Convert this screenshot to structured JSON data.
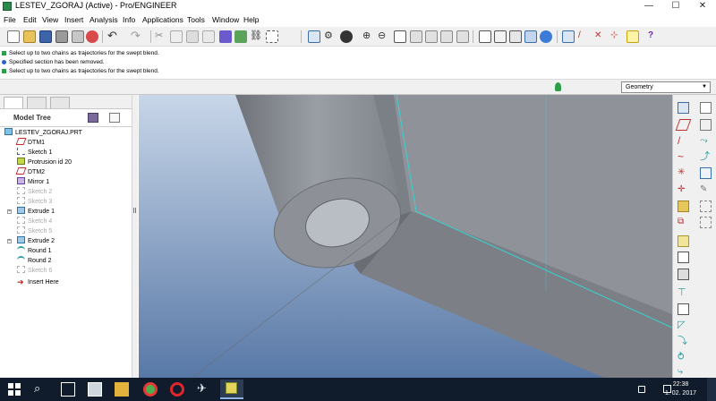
{
  "window": {
    "title": "LESTEV_ZGORAJ (Active) - Pro/ENGINEER",
    "minimize": "—",
    "maximize": "☐",
    "close": "✕"
  },
  "menu": [
    "File",
    "Edit",
    "View",
    "Insert",
    "Analysis",
    "Info",
    "Applications",
    "Tools",
    "Window",
    "Help"
  ],
  "messages": [
    "Select up to two chains as trajectories for the swept blend.",
    "Specified section has been removed.",
    "Select up to two chains as trajectories for the swept blend."
  ],
  "filter": {
    "value": "Geometry"
  },
  "navigator": {
    "header": "Model Tree",
    "items": [
      {
        "label": "LESTEV_ZGORAJ.PRT",
        "icon": "part-icon",
        "dim": false
      },
      {
        "label": "DTM1",
        "icon": "datum-plane-icon",
        "dim": false
      },
      {
        "label": "Sketch 1",
        "icon": "sketch-icon",
        "dim": false
      },
      {
        "label": "Protrusion id 20",
        "icon": "protrusion-icon",
        "dim": false
      },
      {
        "label": "DTM2",
        "icon": "datum-plane-icon",
        "dim": false
      },
      {
        "label": "Mirror 1",
        "icon": "mirror-icon",
        "dim": false
      },
      {
        "label": "Sketch 2",
        "icon": "sketch-icon",
        "dim": true
      },
      {
        "label": "Sketch 3",
        "icon": "sketch-icon",
        "dim": true
      },
      {
        "label": "Extrude 1",
        "icon": "extrude-icon",
        "dim": false
      },
      {
        "label": "Sketch 4",
        "icon": "sketch-icon",
        "dim": true
      },
      {
        "label": "Sketch 5",
        "icon": "sketch-icon",
        "dim": true
      },
      {
        "label": "Extrude 2",
        "icon": "extrude-icon",
        "dim": false
      },
      {
        "label": "Round 1",
        "icon": "round-icon",
        "dim": false
      },
      {
        "label": "Round 2",
        "icon": "round-icon",
        "dim": false
      },
      {
        "label": "Sketch 6",
        "icon": "sketch-icon",
        "dim": true
      },
      {
        "label": "Insert Here",
        "icon": "insert-here-icon",
        "dim": false
      }
    ]
  },
  "taskbar": {
    "time": "22:38",
    "date": "1. 02. 2017"
  },
  "colors": {
    "viewport_top": "#c8d6e8",
    "viewport_bottom": "#5878a6",
    "model_gray": "#8c9096",
    "edge_cyan": "#39d1d1",
    "taskbar": "#101c2c"
  }
}
